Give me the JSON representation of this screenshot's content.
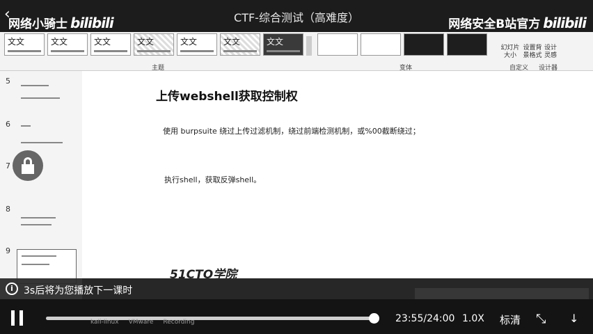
{
  "window_title": "CTF-综合测试（高难度）",
  "watermark_left": {
    "text": "网络小骑士",
    "logo": "bilibili"
  },
  "watermark_right": {
    "text": "网络安全B站官方",
    "logo": "bilibili"
  },
  "ribbon": {
    "themes": [
      "文文",
      "文文",
      "文文",
      "文文",
      "文文",
      "文文",
      "文文"
    ],
    "groups": {
      "theme": "主题",
      "variant": "变体",
      "customize": "自定义",
      "designer": "设计器"
    },
    "buttons": {
      "slide_size": "幻灯片大小",
      "format_bg": "设置背景格式",
      "design_ideas": "设计灵感"
    }
  },
  "thumbnails": [
    {
      "num": "5"
    },
    {
      "num": "6"
    },
    {
      "num": "7"
    },
    {
      "num": "8"
    },
    {
      "num": "9"
    }
  ],
  "slide": {
    "title": "上传webshell获取控制权",
    "line1": "使用 burpsuite 绕过上传过滤机制，绕过前端检测机制，或%00截断绕过；",
    "line2": "执行shell，获取反弹shell。",
    "logo": "51CTO学院"
  },
  "notification": {
    "text": "3s后将为您播放下一课时",
    "icon": "info-icon"
  },
  "player": {
    "current_time": "23:55",
    "total_time": "24:00",
    "time_display": "23:55/24:00",
    "speed": "1.0X",
    "quality": "标清",
    "progress": 0.99
  },
  "taskbar": [
    "kali-linux",
    "VMware",
    "Recording"
  ],
  "colors": {
    "bg": "#1a1a1a",
    "slide": "#ffffff",
    "ribbon": "#f3f3f3"
  }
}
